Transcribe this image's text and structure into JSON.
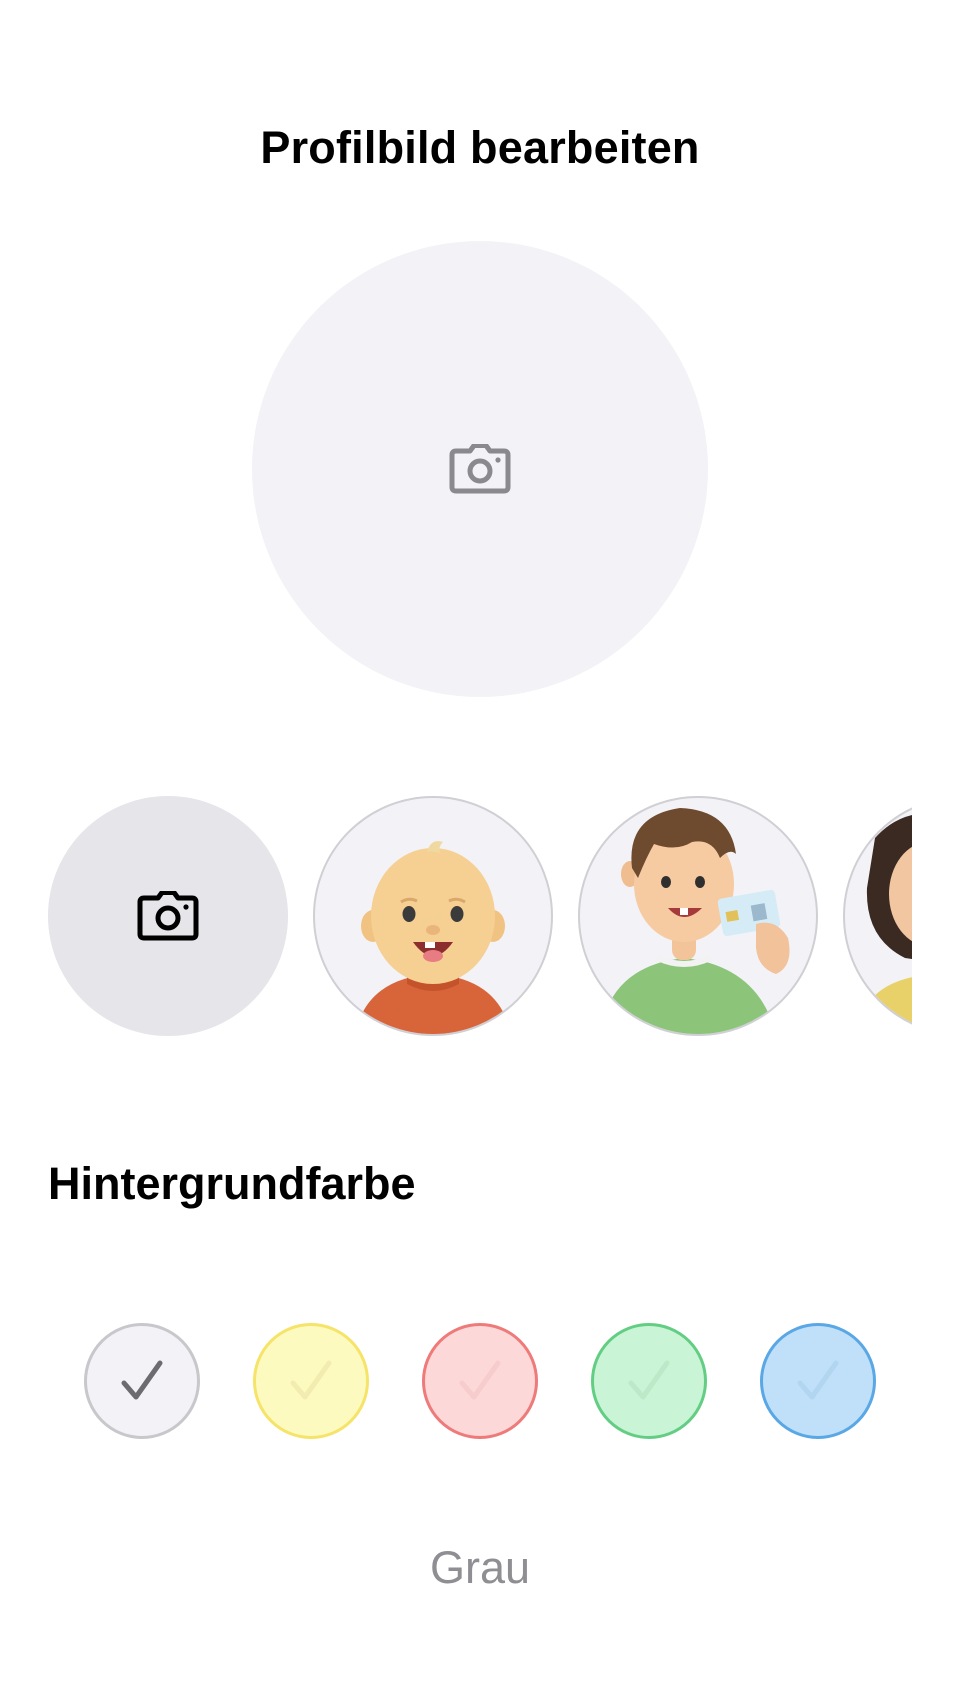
{
  "header": {
    "title": "Profilbild bearbeiten"
  },
  "preview": {
    "icon": "camera-icon",
    "background": "#f2f2f7"
  },
  "avatars": [
    {
      "kind": "camera",
      "icon": "camera-icon"
    },
    {
      "kind": "illustration",
      "subject": "baby-avatar"
    },
    {
      "kind": "illustration",
      "subject": "boy-with-id-card-avatar"
    },
    {
      "kind": "illustration",
      "subject": "woman-avatar"
    }
  ],
  "background_color": {
    "section_title": "Hintergrundfarbe",
    "selected_label": "Grau",
    "swatches": [
      {
        "id": "grey",
        "fill": "#f2f2f7",
        "border": "#c7c7cc",
        "selected": true
      },
      {
        "id": "yellow",
        "fill": "#fdfabf",
        "border": "#f5e36a",
        "selected": false
      },
      {
        "id": "red",
        "fill": "#fdd8d8",
        "border": "#ee7a7a",
        "selected": false
      },
      {
        "id": "green",
        "fill": "#c9f4d6",
        "border": "#63cd84",
        "selected": false
      },
      {
        "id": "blue",
        "fill": "#bfe0f8",
        "border": "#5aa7e6",
        "selected": false
      }
    ]
  }
}
